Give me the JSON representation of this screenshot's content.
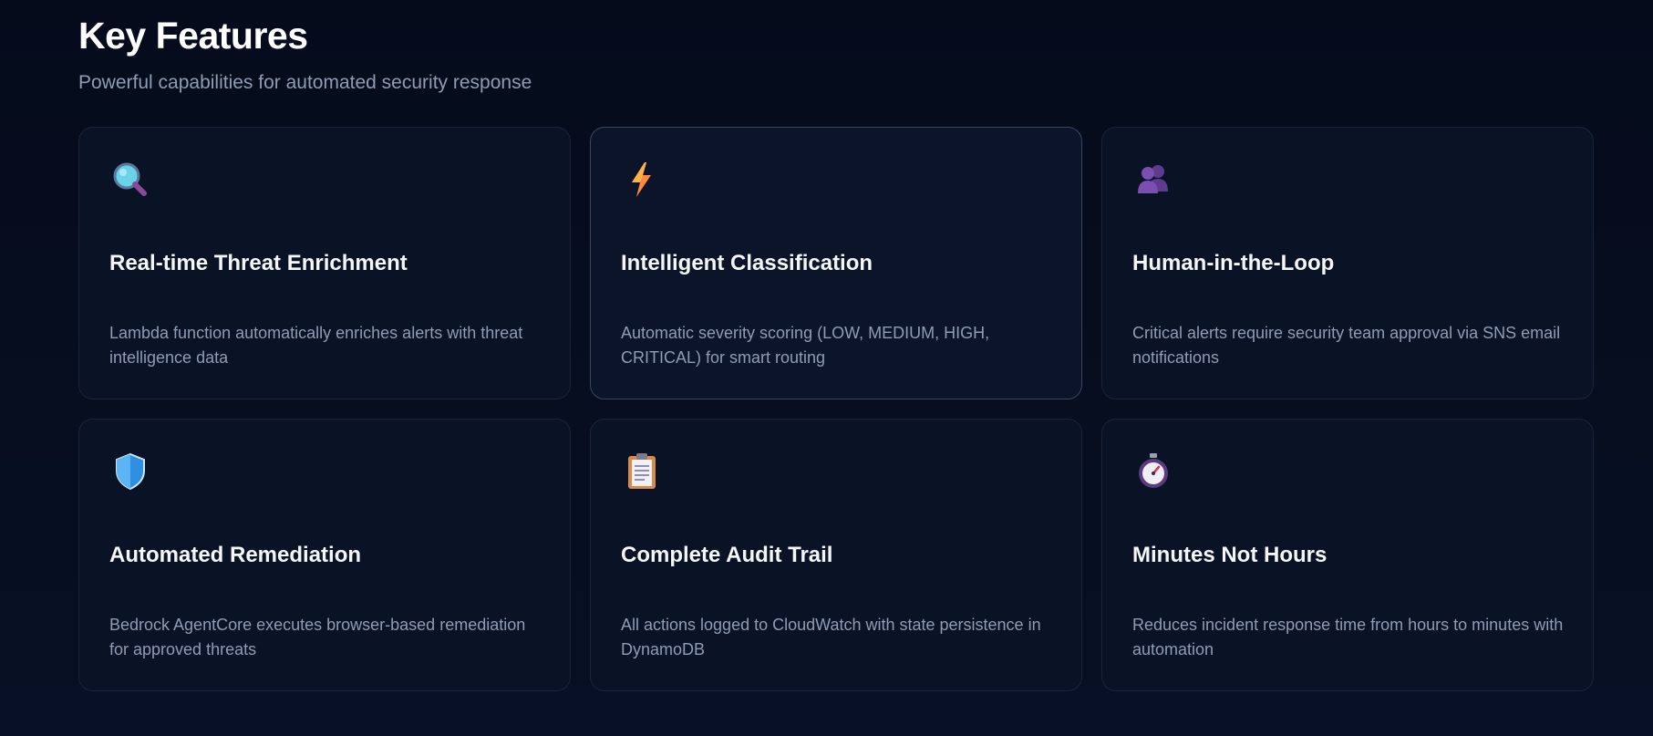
{
  "header": {
    "title": "Key Features",
    "subtitle": "Powerful capabilities for automated security response"
  },
  "features": [
    {
      "icon": "magnifying-glass-icon",
      "title": "Real-time Threat Enrichment",
      "description": "Lambda function automatically enriches alerts with threat intelligence data"
    },
    {
      "icon": "lightning-bolt-icon",
      "title": "Intelligent Classification",
      "description": "Automatic severity scoring (LOW, MEDIUM, HIGH, CRITICAL) for smart routing"
    },
    {
      "icon": "people-icon",
      "title": "Human-in-the-Loop",
      "description": "Critical alerts require security team approval via SNS email notifications"
    },
    {
      "icon": "shield-icon",
      "title": "Automated Remediation",
      "description": "Bedrock AgentCore executes browser-based remediation for approved threats"
    },
    {
      "icon": "clipboard-icon",
      "title": "Complete Audit Trail",
      "description": "All actions logged to CloudWatch with state persistence in DynamoDB"
    },
    {
      "icon": "stopwatch-icon",
      "title": "Minutes Not Hours",
      "description": "Reduces incident response time from hours to minutes with automation"
    }
  ],
  "colors": {
    "background": "#060c1d",
    "card_background": "#0a1225",
    "card_border": "#1b2438",
    "title_text": "#ffffff",
    "muted_text": "#8f9cb4"
  }
}
